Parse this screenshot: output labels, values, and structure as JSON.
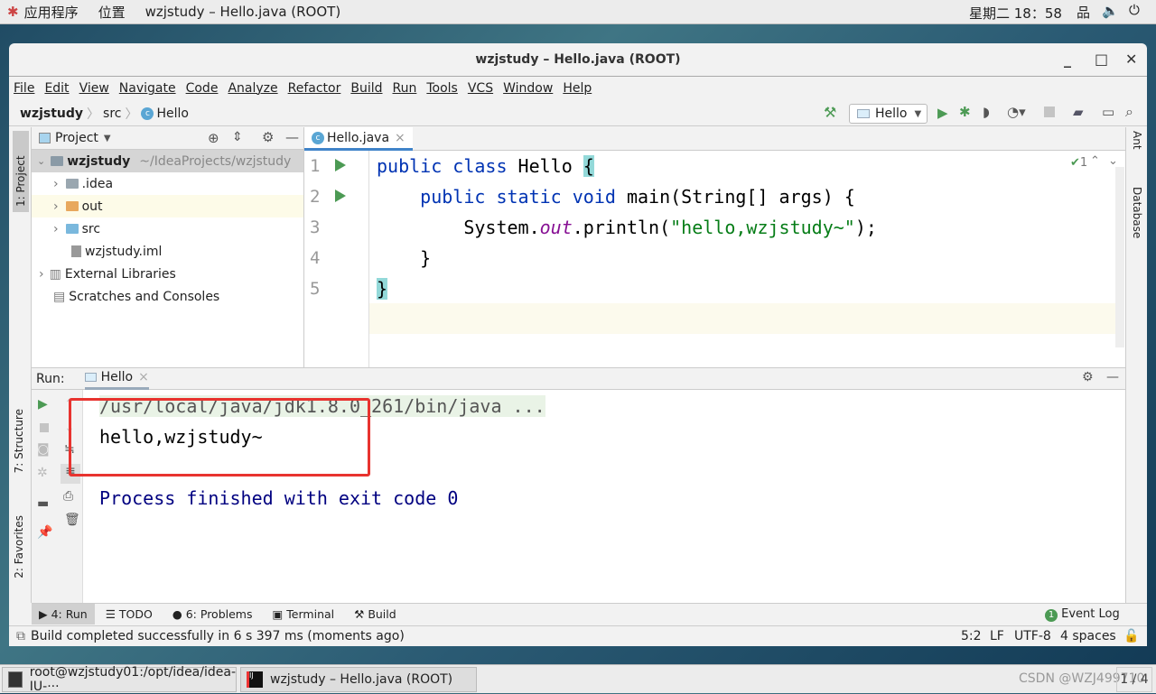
{
  "topbar": {
    "apps": "应用程序",
    "places": "位置",
    "active_window": "wzjstudy – Hello.java (ROOT)",
    "clock": "星期二 18：58"
  },
  "window": {
    "title": "wzjstudy – Hello.java (ROOT)"
  },
  "menu": [
    "File",
    "Edit",
    "View",
    "Navigate",
    "Code",
    "Analyze",
    "Refactor",
    "Build",
    "Run",
    "Tools",
    "VCS",
    "Window",
    "Help"
  ],
  "breadcrumb": [
    "wzjstudy",
    "src",
    "Hello"
  ],
  "toolbar": {
    "run_config": "Hello"
  },
  "left_stripe": {
    "project": "1: Project",
    "structure": "7: Structure",
    "favorites": "2: Favorites"
  },
  "right_stripe": {
    "ant": "Ant",
    "database": "Database"
  },
  "project": {
    "header": "Project",
    "root": "wzjstudy",
    "root_path": "~/IdeaProjects/wzjstudy",
    "items": [
      ".idea",
      "out",
      "src",
      "wzjstudy.iml"
    ],
    "external": "External Libraries",
    "scratches": "Scratches and Consoles"
  },
  "editor": {
    "tab": "Hello.java",
    "inspection_count": "1",
    "line_numbers": [
      "1",
      "2",
      "3",
      "4",
      "5"
    ],
    "lines": {
      "l1a": "public class ",
      "l1b": "Hello ",
      "l1c": "{",
      "l2a": "    public static void ",
      "l2b": "main(String[] args) {",
      "l3a": "        System.",
      "l3b": "out",
      "l3c": ".println(",
      "l3d": "\"hello,wzjstudy~\"",
      "l3e": ");",
      "l4": "    }",
      "l5": "}"
    }
  },
  "run": {
    "label": "Run:",
    "tab": "Hello",
    "cmd": "/usr/local/java/jdk1.8.0_261/bin/java ...",
    "output": "hello,wzjstudy~",
    "exit": "Process finished with exit code 0"
  },
  "toolwindows": {
    "run": "4: Run",
    "todo": "TODO",
    "problems": "6: Problems",
    "terminal": "Terminal",
    "build": "Build",
    "event_log": "Event Log",
    "event_count": "1"
  },
  "status": {
    "message": "Build completed successfully in 6 s 397 ms (moments ago)",
    "position": "5:2",
    "line_sep": "LF",
    "encoding": "UTF-8",
    "indent": "4 spaces"
  },
  "taskbar": {
    "terminal": "root@wzjstudy01:/opt/idea/idea-IU-···",
    "idea": "wzjstudy – Hello.java (ROOT)",
    "workspace": "1 / 4",
    "watermark": "CSDN @WZJ499710"
  }
}
